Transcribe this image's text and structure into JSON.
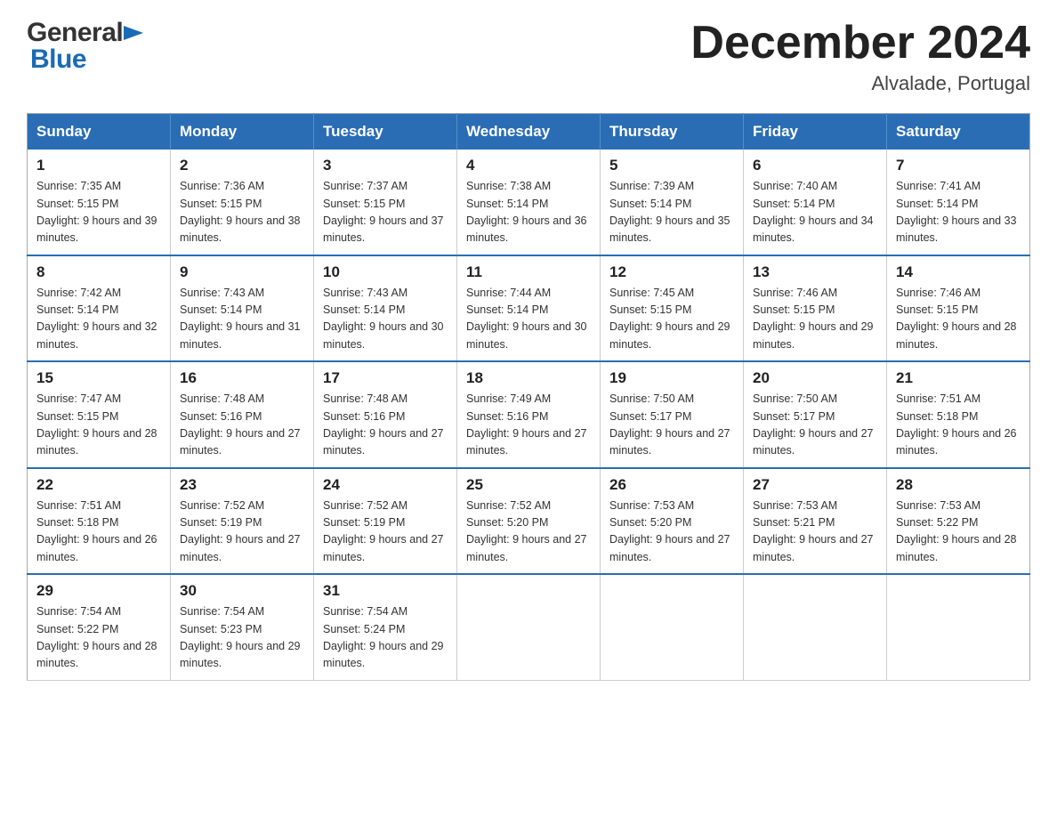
{
  "header": {
    "logo_general": "General",
    "logo_blue": "Blue",
    "title": "December 2024",
    "subtitle": "Alvalade, Portugal"
  },
  "columns": [
    "Sunday",
    "Monday",
    "Tuesday",
    "Wednesday",
    "Thursday",
    "Friday",
    "Saturday"
  ],
  "weeks": [
    [
      {
        "day": "1",
        "sunrise": "Sunrise: 7:35 AM",
        "sunset": "Sunset: 5:15 PM",
        "daylight": "Daylight: 9 hours and 39 minutes."
      },
      {
        "day": "2",
        "sunrise": "Sunrise: 7:36 AM",
        "sunset": "Sunset: 5:15 PM",
        "daylight": "Daylight: 9 hours and 38 minutes."
      },
      {
        "day": "3",
        "sunrise": "Sunrise: 7:37 AM",
        "sunset": "Sunset: 5:15 PM",
        "daylight": "Daylight: 9 hours and 37 minutes."
      },
      {
        "day": "4",
        "sunrise": "Sunrise: 7:38 AM",
        "sunset": "Sunset: 5:14 PM",
        "daylight": "Daylight: 9 hours and 36 minutes."
      },
      {
        "day": "5",
        "sunrise": "Sunrise: 7:39 AM",
        "sunset": "Sunset: 5:14 PM",
        "daylight": "Daylight: 9 hours and 35 minutes."
      },
      {
        "day": "6",
        "sunrise": "Sunrise: 7:40 AM",
        "sunset": "Sunset: 5:14 PM",
        "daylight": "Daylight: 9 hours and 34 minutes."
      },
      {
        "day": "7",
        "sunrise": "Sunrise: 7:41 AM",
        "sunset": "Sunset: 5:14 PM",
        "daylight": "Daylight: 9 hours and 33 minutes."
      }
    ],
    [
      {
        "day": "8",
        "sunrise": "Sunrise: 7:42 AM",
        "sunset": "Sunset: 5:14 PM",
        "daylight": "Daylight: 9 hours and 32 minutes."
      },
      {
        "day": "9",
        "sunrise": "Sunrise: 7:43 AM",
        "sunset": "Sunset: 5:14 PM",
        "daylight": "Daylight: 9 hours and 31 minutes."
      },
      {
        "day": "10",
        "sunrise": "Sunrise: 7:43 AM",
        "sunset": "Sunset: 5:14 PM",
        "daylight": "Daylight: 9 hours and 30 minutes."
      },
      {
        "day": "11",
        "sunrise": "Sunrise: 7:44 AM",
        "sunset": "Sunset: 5:14 PM",
        "daylight": "Daylight: 9 hours and 30 minutes."
      },
      {
        "day": "12",
        "sunrise": "Sunrise: 7:45 AM",
        "sunset": "Sunset: 5:15 PM",
        "daylight": "Daylight: 9 hours and 29 minutes."
      },
      {
        "day": "13",
        "sunrise": "Sunrise: 7:46 AM",
        "sunset": "Sunset: 5:15 PM",
        "daylight": "Daylight: 9 hours and 29 minutes."
      },
      {
        "day": "14",
        "sunrise": "Sunrise: 7:46 AM",
        "sunset": "Sunset: 5:15 PM",
        "daylight": "Daylight: 9 hours and 28 minutes."
      }
    ],
    [
      {
        "day": "15",
        "sunrise": "Sunrise: 7:47 AM",
        "sunset": "Sunset: 5:15 PM",
        "daylight": "Daylight: 9 hours and 28 minutes."
      },
      {
        "day": "16",
        "sunrise": "Sunrise: 7:48 AM",
        "sunset": "Sunset: 5:16 PM",
        "daylight": "Daylight: 9 hours and 27 minutes."
      },
      {
        "day": "17",
        "sunrise": "Sunrise: 7:48 AM",
        "sunset": "Sunset: 5:16 PM",
        "daylight": "Daylight: 9 hours and 27 minutes."
      },
      {
        "day": "18",
        "sunrise": "Sunrise: 7:49 AM",
        "sunset": "Sunset: 5:16 PM",
        "daylight": "Daylight: 9 hours and 27 minutes."
      },
      {
        "day": "19",
        "sunrise": "Sunrise: 7:50 AM",
        "sunset": "Sunset: 5:17 PM",
        "daylight": "Daylight: 9 hours and 27 minutes."
      },
      {
        "day": "20",
        "sunrise": "Sunrise: 7:50 AM",
        "sunset": "Sunset: 5:17 PM",
        "daylight": "Daylight: 9 hours and 27 minutes."
      },
      {
        "day": "21",
        "sunrise": "Sunrise: 7:51 AM",
        "sunset": "Sunset: 5:18 PM",
        "daylight": "Daylight: 9 hours and 26 minutes."
      }
    ],
    [
      {
        "day": "22",
        "sunrise": "Sunrise: 7:51 AM",
        "sunset": "Sunset: 5:18 PM",
        "daylight": "Daylight: 9 hours and 26 minutes."
      },
      {
        "day": "23",
        "sunrise": "Sunrise: 7:52 AM",
        "sunset": "Sunset: 5:19 PM",
        "daylight": "Daylight: 9 hours and 27 minutes."
      },
      {
        "day": "24",
        "sunrise": "Sunrise: 7:52 AM",
        "sunset": "Sunset: 5:19 PM",
        "daylight": "Daylight: 9 hours and 27 minutes."
      },
      {
        "day": "25",
        "sunrise": "Sunrise: 7:52 AM",
        "sunset": "Sunset: 5:20 PM",
        "daylight": "Daylight: 9 hours and 27 minutes."
      },
      {
        "day": "26",
        "sunrise": "Sunrise: 7:53 AM",
        "sunset": "Sunset: 5:20 PM",
        "daylight": "Daylight: 9 hours and 27 minutes."
      },
      {
        "day": "27",
        "sunrise": "Sunrise: 7:53 AM",
        "sunset": "Sunset: 5:21 PM",
        "daylight": "Daylight: 9 hours and 27 minutes."
      },
      {
        "day": "28",
        "sunrise": "Sunrise: 7:53 AM",
        "sunset": "Sunset: 5:22 PM",
        "daylight": "Daylight: 9 hours and 28 minutes."
      }
    ],
    [
      {
        "day": "29",
        "sunrise": "Sunrise: 7:54 AM",
        "sunset": "Sunset: 5:22 PM",
        "daylight": "Daylight: 9 hours and 28 minutes."
      },
      {
        "day": "30",
        "sunrise": "Sunrise: 7:54 AM",
        "sunset": "Sunset: 5:23 PM",
        "daylight": "Daylight: 9 hours and 29 minutes."
      },
      {
        "day": "31",
        "sunrise": "Sunrise: 7:54 AM",
        "sunset": "Sunset: 5:24 PM",
        "daylight": "Daylight: 9 hours and 29 minutes."
      },
      null,
      null,
      null,
      null
    ]
  ]
}
